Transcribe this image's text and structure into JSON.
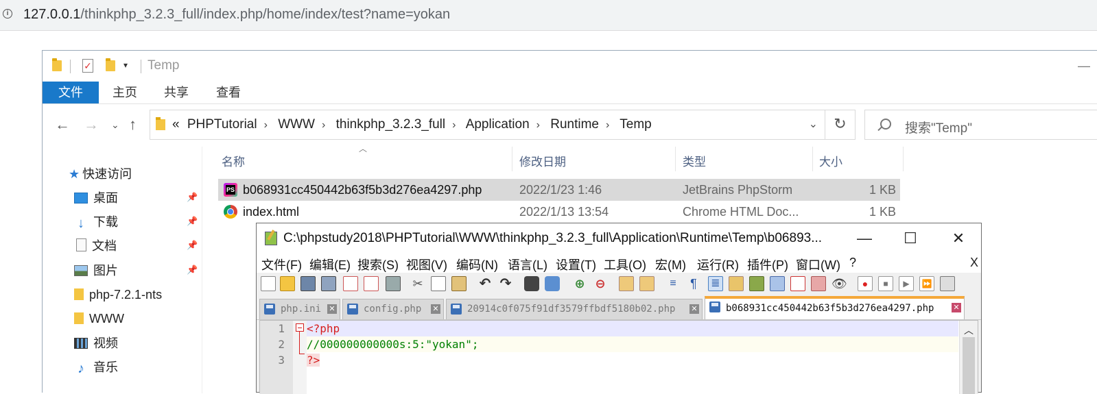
{
  "browser": {
    "url_host": "127.0.0.1",
    "url_path": "/thinkphp_3.2.3_full/index.php/home/index/test?name=yokan"
  },
  "explorer": {
    "title": "Temp",
    "ribbon_tabs": [
      "文件",
      "主页",
      "共享",
      "查看"
    ],
    "breadcrumb": [
      "«",
      "PHPTutorial",
      "WWW",
      "thinkphp_3.2.3_full",
      "Application",
      "Runtime",
      "Temp"
    ],
    "search_placeholder": "搜索\"Temp\"",
    "nav_pane": {
      "quick_access": "快速访问",
      "items": [
        {
          "label": "桌面",
          "icon": "desktop-icon",
          "pinned": true
        },
        {
          "label": "下载",
          "icon": "download-icon",
          "pinned": true
        },
        {
          "label": "文档",
          "icon": "documents-icon",
          "pinned": true
        },
        {
          "label": "图片",
          "icon": "pictures-icon",
          "pinned": true
        },
        {
          "label": "php-7.2.1-nts",
          "icon": "folder-icon",
          "pinned": false
        },
        {
          "label": "WWW",
          "icon": "folder-icon",
          "pinned": false
        },
        {
          "label": "视频",
          "icon": "videos-icon",
          "pinned": false
        },
        {
          "label": "音乐",
          "icon": "music-icon",
          "pinned": false
        }
      ]
    },
    "columns": [
      "名称",
      "修改日期",
      "类型",
      "大小"
    ],
    "files": [
      {
        "name": "b068931cc450442b63f5b3d276ea4297.php",
        "date": "2022/1/23 1:46",
        "type": "JetBrains PhpStorm",
        "size": "1 KB",
        "icon": "phpstorm-icon",
        "selected": true
      },
      {
        "name": "index.html",
        "date": "2022/1/13 13:54",
        "type": "Chrome HTML Doc...",
        "size": "1 KB",
        "icon": "chrome-icon",
        "selected": false
      }
    ]
  },
  "notepad": {
    "title": "C:\\phpstudy2018\\PHPTutorial\\WWW\\thinkphp_3.2.3_full\\Application\\Runtime\\Temp\\b06893...",
    "menu": [
      "文件(F)",
      "编辑(E)",
      "搜索(S)",
      "视图(V)",
      "编码(N)",
      "语言(L)",
      "设置(T)",
      "工具(O)",
      "宏(M)",
      "运行(R)",
      "插件(P)",
      "窗口(W)",
      "?"
    ],
    "menu_close": "X",
    "tabs": [
      {
        "label": "php.ini",
        "active": false
      },
      {
        "label": "config.php",
        "active": false
      },
      {
        "label": "20914c0f075f91df3579ffbdf5180b02.php",
        "active": false
      },
      {
        "label": "b068931cc450442b63f5b3d276ea4297.php",
        "active": true
      }
    ],
    "lines": [
      {
        "num": "1",
        "text": "<?php"
      },
      {
        "num": "2",
        "text": "//000000000000s:5:\"yokan\";"
      },
      {
        "num": "3",
        "text": "?>"
      }
    ]
  },
  "colors": {
    "ribbon_active": "#1979ca",
    "active_tab_accent": "#f4a83a",
    "php_tag": "#d61e1e",
    "comment": "#008000"
  }
}
